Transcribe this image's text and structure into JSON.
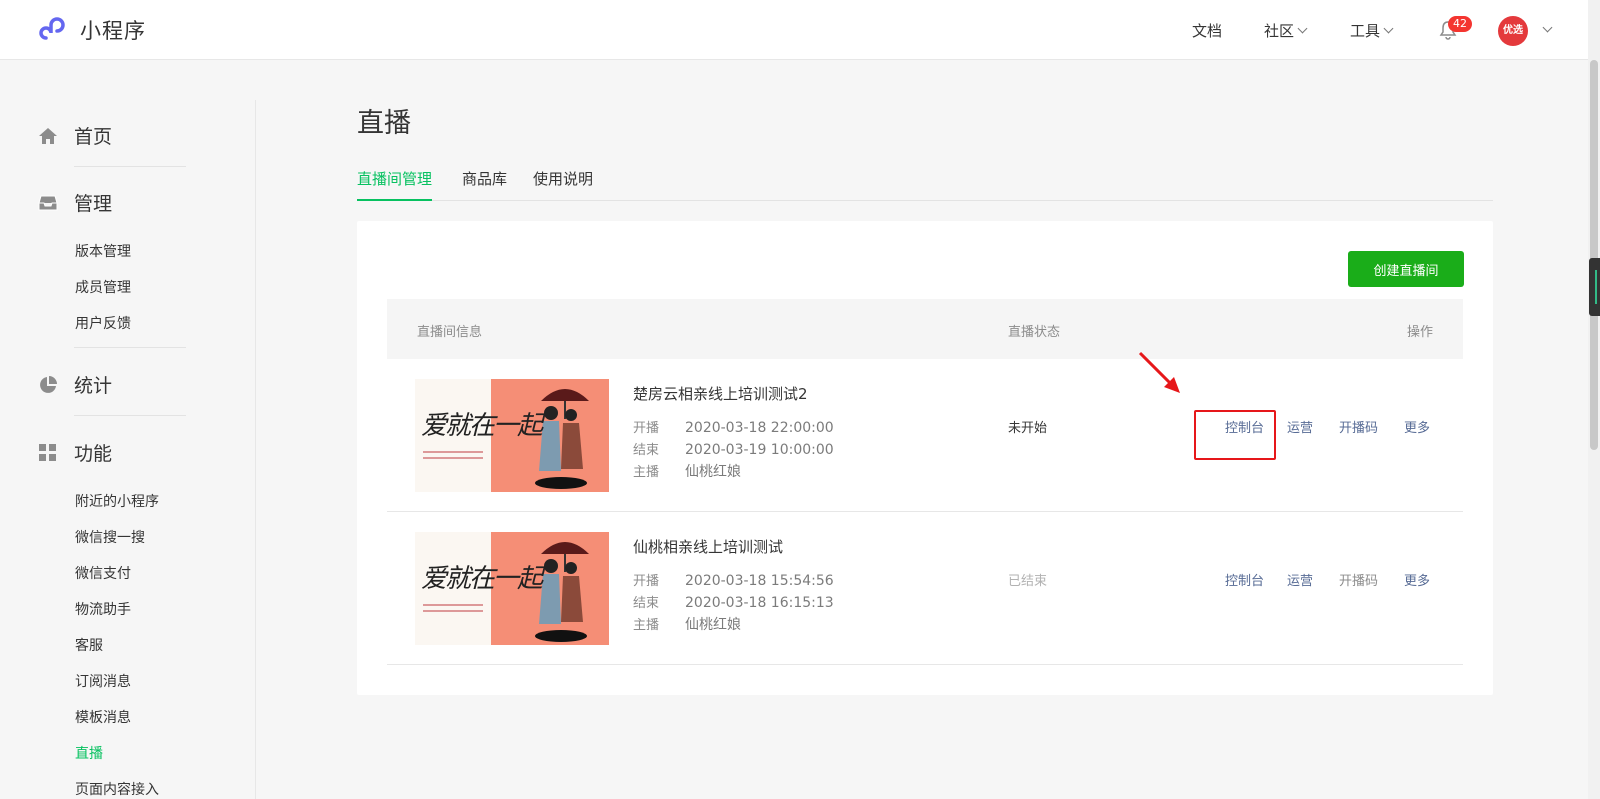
{
  "app": {
    "name": "小程序"
  },
  "topnav": {
    "docs": "文档",
    "community": "社区",
    "tools": "工具",
    "notifications_count": "42",
    "avatar_text": "优选"
  },
  "sidebar": {
    "groups": [
      {
        "label": "首页",
        "icon": "home-icon"
      },
      {
        "label": "管理",
        "icon": "inbox-icon",
        "items": [
          "版本管理",
          "成员管理",
          "用户反馈"
        ]
      },
      {
        "label": "统计",
        "icon": "pie-chart-icon"
      },
      {
        "label": "功能",
        "icon": "grid-icon",
        "items": [
          "附近的小程序",
          "微信搜一搜",
          "微信支付",
          "物流助手",
          "客服",
          "订阅消息",
          "模板消息",
          "直播",
          "页面内容接入"
        ]
      }
    ],
    "active_item": "直播"
  },
  "page": {
    "title": "直播",
    "tabs": [
      "直播间管理",
      "商品库",
      "使用说明"
    ],
    "active_tab": "直播间管理",
    "create_button": "创建直播间"
  },
  "table": {
    "headers": [
      "直播间信息",
      "直播状态",
      "操作"
    ],
    "meta_labels": {
      "start": "开播",
      "end": "结束",
      "host": "主播"
    },
    "cover_text": "爱就在一起",
    "rows": [
      {
        "title": "楚房云相亲线上培训测试2",
        "start": "2020-03-18 22:00:00",
        "end": "2020-03-19 10:00:00",
        "host": "仙桃红娘",
        "status": "未开始",
        "actions": [
          "控制台",
          "运营",
          "开播码",
          "更多"
        ]
      },
      {
        "title": "仙桃相亲线上培训测试",
        "start": "2020-03-18 15:54:56",
        "end": "2020-03-18 16:15:13",
        "host": "仙桃红娘",
        "status": "已结束",
        "actions": [
          "控制台",
          "运营",
          "开播码",
          "更多"
        ]
      }
    ]
  },
  "colors": {
    "accent_green": "#07c160",
    "button_green": "#1aad19",
    "link_blue": "#576b95",
    "annotation_red": "#e6171a",
    "badge_red": "#f43530"
  }
}
